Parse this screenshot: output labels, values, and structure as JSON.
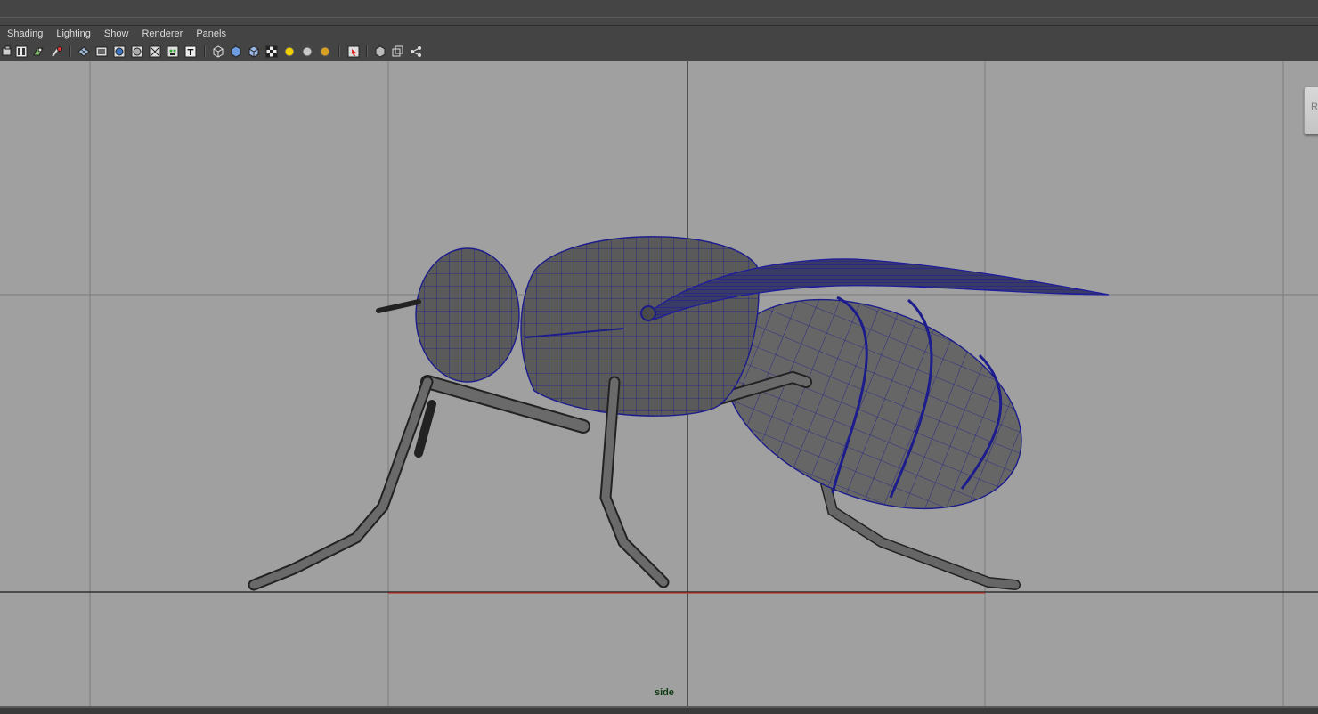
{
  "menu": {
    "items": [
      {
        "label": "Shading"
      },
      {
        "label": "Lighting"
      },
      {
        "label": "Show"
      },
      {
        "label": "Renderer"
      },
      {
        "label": "Panels"
      }
    ]
  },
  "toolbar": {
    "icons": [
      "select-camera-icon",
      "camera-attributes-icon",
      "bookmark-icon",
      "image-plane-icon",
      "grid-icon",
      "film-gate-icon",
      "resolution-gate-icon",
      "field-chart-icon",
      "safe-action-icon",
      "safe-title-icon",
      "gate-mask-icon",
      "text-icon",
      "wireframe-icon",
      "smooth-shade-icon",
      "wireframe-on-shaded-icon",
      "textured-icon",
      "use-all-lights-icon",
      "shadows-icon",
      "ambient-occlusion-icon",
      "antialiasing-icon",
      "isolate-select-icon",
      "xray-icon",
      "xray-joints-icon",
      "xray-components-icon"
    ]
  },
  "viewport": {
    "camera_label": "side",
    "background_color": "#a0a0a0",
    "grid_color": "#7d7d7d",
    "axis_color": "#1a1a1a",
    "ground_line_color": "#c0392b",
    "wire_color": "#1c1c8c",
    "mesh_fill_color": "#5c5c5c"
  },
  "side_tab": {
    "label": "R"
  }
}
